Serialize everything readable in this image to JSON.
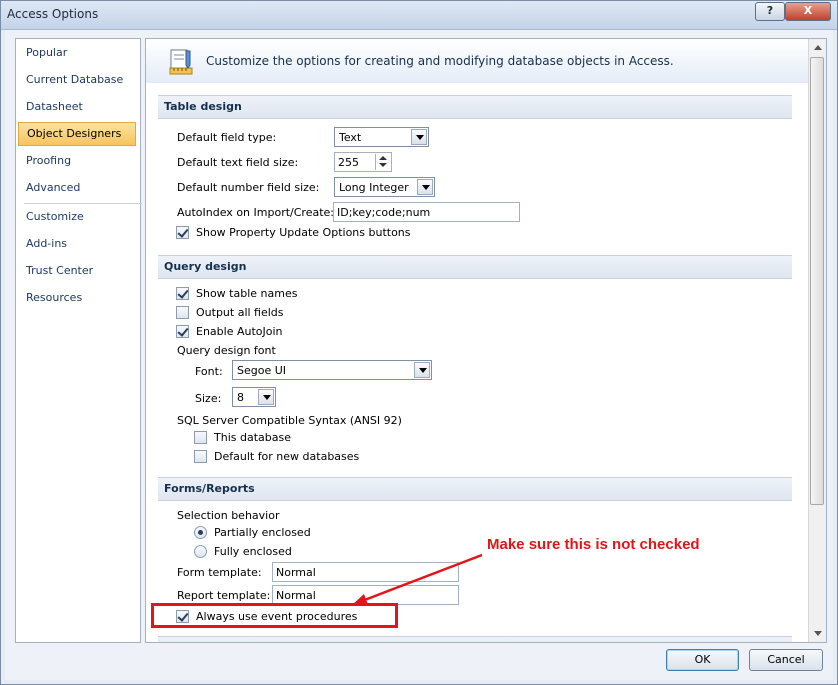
{
  "window": {
    "title": "Access Options",
    "help_label": "?",
    "close_label": "X"
  },
  "sidebar": {
    "items": [
      {
        "label": "Popular"
      },
      {
        "label": "Current Database"
      },
      {
        "label": "Datasheet"
      },
      {
        "label": "Object Designers",
        "selected": true
      },
      {
        "label": "Proofing"
      },
      {
        "label": "Advanced"
      },
      {
        "label": "Customize"
      },
      {
        "label": "Add-ins"
      },
      {
        "label": "Trust Center"
      },
      {
        "label": "Resources"
      }
    ]
  },
  "header": {
    "text": "Customize the options for creating and modifying database objects in Access.",
    "icon": "ruler-pencil-icon"
  },
  "table_design": {
    "title": "Table design",
    "field_type_label": "Default field type:",
    "field_type_value": "Text",
    "text_size_label": "Default text field size:",
    "text_size_value": "255",
    "number_size_label": "Default number field size:",
    "number_size_value": "Long Integer",
    "autoindex_label": "AutoIndex on Import/Create:",
    "autoindex_value": "ID;key;code;num",
    "property_update_label": "Show Property Update Options buttons",
    "property_update_checked": true
  },
  "query_design": {
    "title": "Query design",
    "table_names_label": "Show table names",
    "table_names_checked": true,
    "output_all_label": "Output all fields",
    "output_all_checked": false,
    "autojoin_label": "Enable AutoJoin",
    "autojoin_checked": true,
    "font_group_label": "Query design font",
    "font_label": "Font:",
    "font_value": "Segoe UI",
    "size_label": "Size:",
    "size_value": "8",
    "sql_label": "SQL Server Compatible Syntax (ANSI 92)",
    "this_db_label": "This database",
    "this_db_checked": false,
    "default_new_label": "Default for new databases",
    "default_new_checked": false
  },
  "forms_reports": {
    "title": "Forms/Reports",
    "selection_label": "Selection behavior",
    "partially_label": "Partially enclosed",
    "partially_selected": true,
    "fully_label": "Fully enclosed",
    "fully_selected": false,
    "form_template_label": "Form template:",
    "form_template_value": "Normal",
    "report_template_label": "Report template:",
    "report_template_value": "Normal",
    "event_procedures_label": "Always use event procedures",
    "event_procedures_checked": true
  },
  "annotation": {
    "text": "Make sure this is not checked",
    "color": "#e3151a"
  },
  "buttons": {
    "ok": "OK",
    "cancel": "Cancel"
  }
}
